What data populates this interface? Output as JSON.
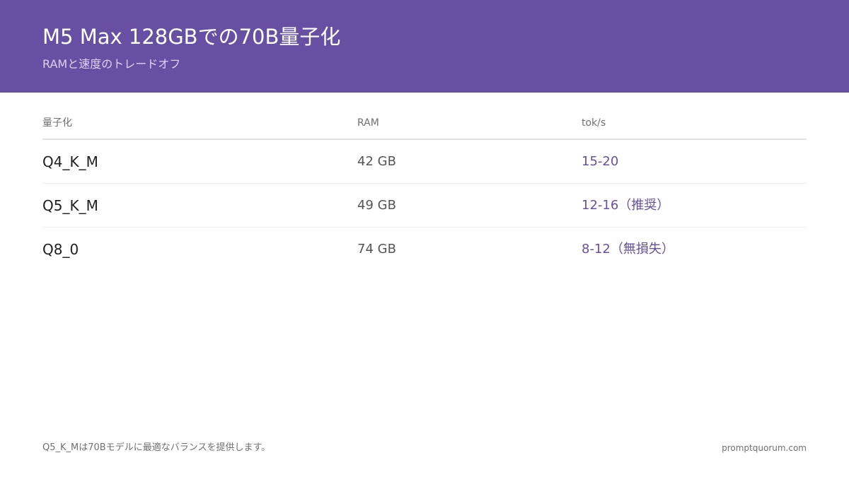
{
  "header": {
    "title": "M5 Max 128GBでの70B量子化",
    "subtitle": "RAMと速度のトレードオフ"
  },
  "table": {
    "headers": [
      "量子化",
      "RAM",
      "tok/s"
    ],
    "rows": [
      {
        "quant": "Q4_K_M",
        "ram": "42 GB",
        "speed": "15-20"
      },
      {
        "quant": "Q5_K_M",
        "ram": "49 GB",
        "speed": "12-16（推奨）"
      },
      {
        "quant": "Q8_0",
        "ram": "74 GB",
        "speed": "8-12（無損失）"
      }
    ]
  },
  "footer": {
    "note": "Q5_K_Mは70Bモデルに最適なバランスを提供します。",
    "site": "promptquorum.com"
  },
  "colors": {
    "accent": "#6750a4",
    "header_text": "#ffffff",
    "subtitle_text": "#ddd3f3"
  }
}
